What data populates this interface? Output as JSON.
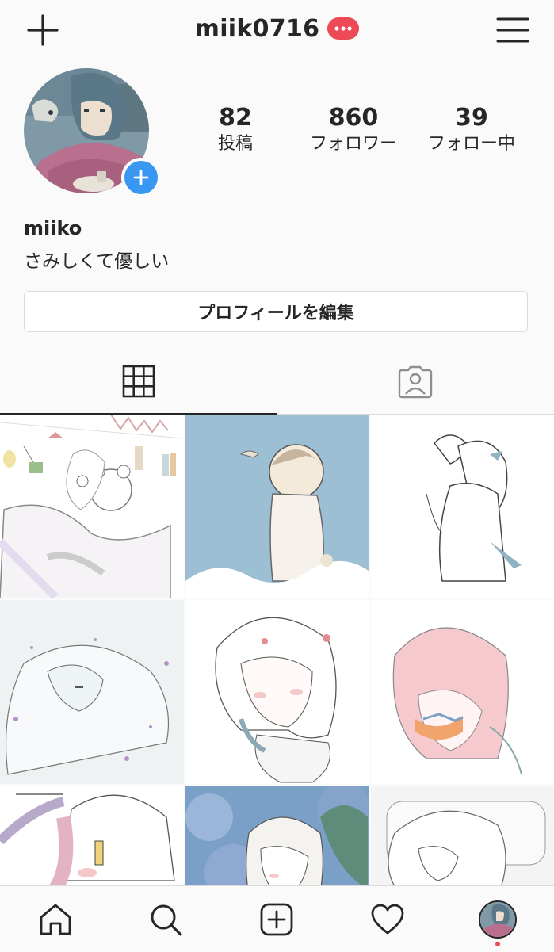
{
  "header": {
    "username": "miik0716",
    "badge_text": "···",
    "badge_color": "#ed4956"
  },
  "profile": {
    "name": "miiko",
    "bio": "さみしくて優しい",
    "edit_label": "プロフィールを編集"
  },
  "stats": [
    {
      "value": "82",
      "label": "投稿"
    },
    {
      "value": "860",
      "label": "フォロワー"
    },
    {
      "value": "39",
      "label": "フォロー中"
    }
  ],
  "tabs": [
    {
      "icon": "grid-icon",
      "active": true
    },
    {
      "icon": "tagged-person-icon",
      "active": false
    }
  ],
  "grid_posts": [
    {
      "subject": "girl hugging teddy bear in bed",
      "bg": "#ffffff"
    },
    {
      "subject": "child looking at fish in blue sky",
      "bg": "#9dbfd3"
    },
    {
      "subject": "girl holding cat",
      "bg": "#ffffff"
    },
    {
      "subject": "girl sleeping under blanket",
      "bg": "#eef2f3"
    },
    {
      "subject": "girl with apples in hair",
      "bg": "#ffffff"
    },
    {
      "subject": "pink-haired girl with flowers",
      "bg": "#ffffff"
    },
    {
      "subject": "girl with long hair",
      "bg": "#ffffff"
    },
    {
      "subject": "girl in blue hydrangeas",
      "bg": "#7aa0c8"
    },
    {
      "subject": "girl resting on pillow",
      "bg": "#f4f4f4"
    }
  ],
  "bottom_nav": [
    {
      "icon": "home-icon"
    },
    {
      "icon": "search-icon"
    },
    {
      "icon": "new-post-icon"
    },
    {
      "icon": "heart-icon"
    },
    {
      "icon": "profile-avatar-icon"
    }
  ],
  "colors": {
    "accent": "#3897f0",
    "text": "#262626",
    "border": "#dbdbdb",
    "background": "#fafafa"
  }
}
